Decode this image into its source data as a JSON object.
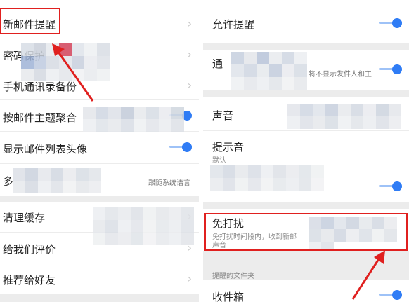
{
  "left": {
    "items": [
      {
        "label": "新邮件提醒",
        "control": "chevron"
      },
      {
        "label": "密码保护",
        "control": "chevron"
      },
      {
        "label": "手机通讯录备份",
        "control": "chevron"
      },
      {
        "label": "按邮件主题聚合",
        "control": "toggle"
      },
      {
        "label": "显示邮件列表头像",
        "control": "toggle"
      },
      {
        "label": "多",
        "value": "跟随系统语言",
        "control": "chevron"
      },
      {
        "label": "清理缓存",
        "control": "chevron"
      },
      {
        "label": "给我们评价",
        "control": "chevron"
      },
      {
        "label": "推荐给好友",
        "control": "chevron"
      }
    ]
  },
  "right": {
    "allow_notifications": {
      "label": "允许提醒",
      "on": true
    },
    "notification_detail": {
      "label": "通",
      "hint": "将不显示发件人和主",
      "on": true
    },
    "sound": {
      "label": "声音"
    },
    "alert_tone": {
      "label": "提示音",
      "value": "默认"
    },
    "hidden_toggle": {
      "on": true
    },
    "do_not_disturb": {
      "label": "免打扰",
      "subtitle_line1": "免打扰时间段内，收到新邮",
      "subtitle_line2": "声音"
    },
    "folder_section_label": "提醒的文件夹",
    "inbox": {
      "label": "收件箱",
      "on": true
    }
  },
  "colors": {
    "accent": "#2f7cf5",
    "highlight_red": "#e0201f"
  }
}
